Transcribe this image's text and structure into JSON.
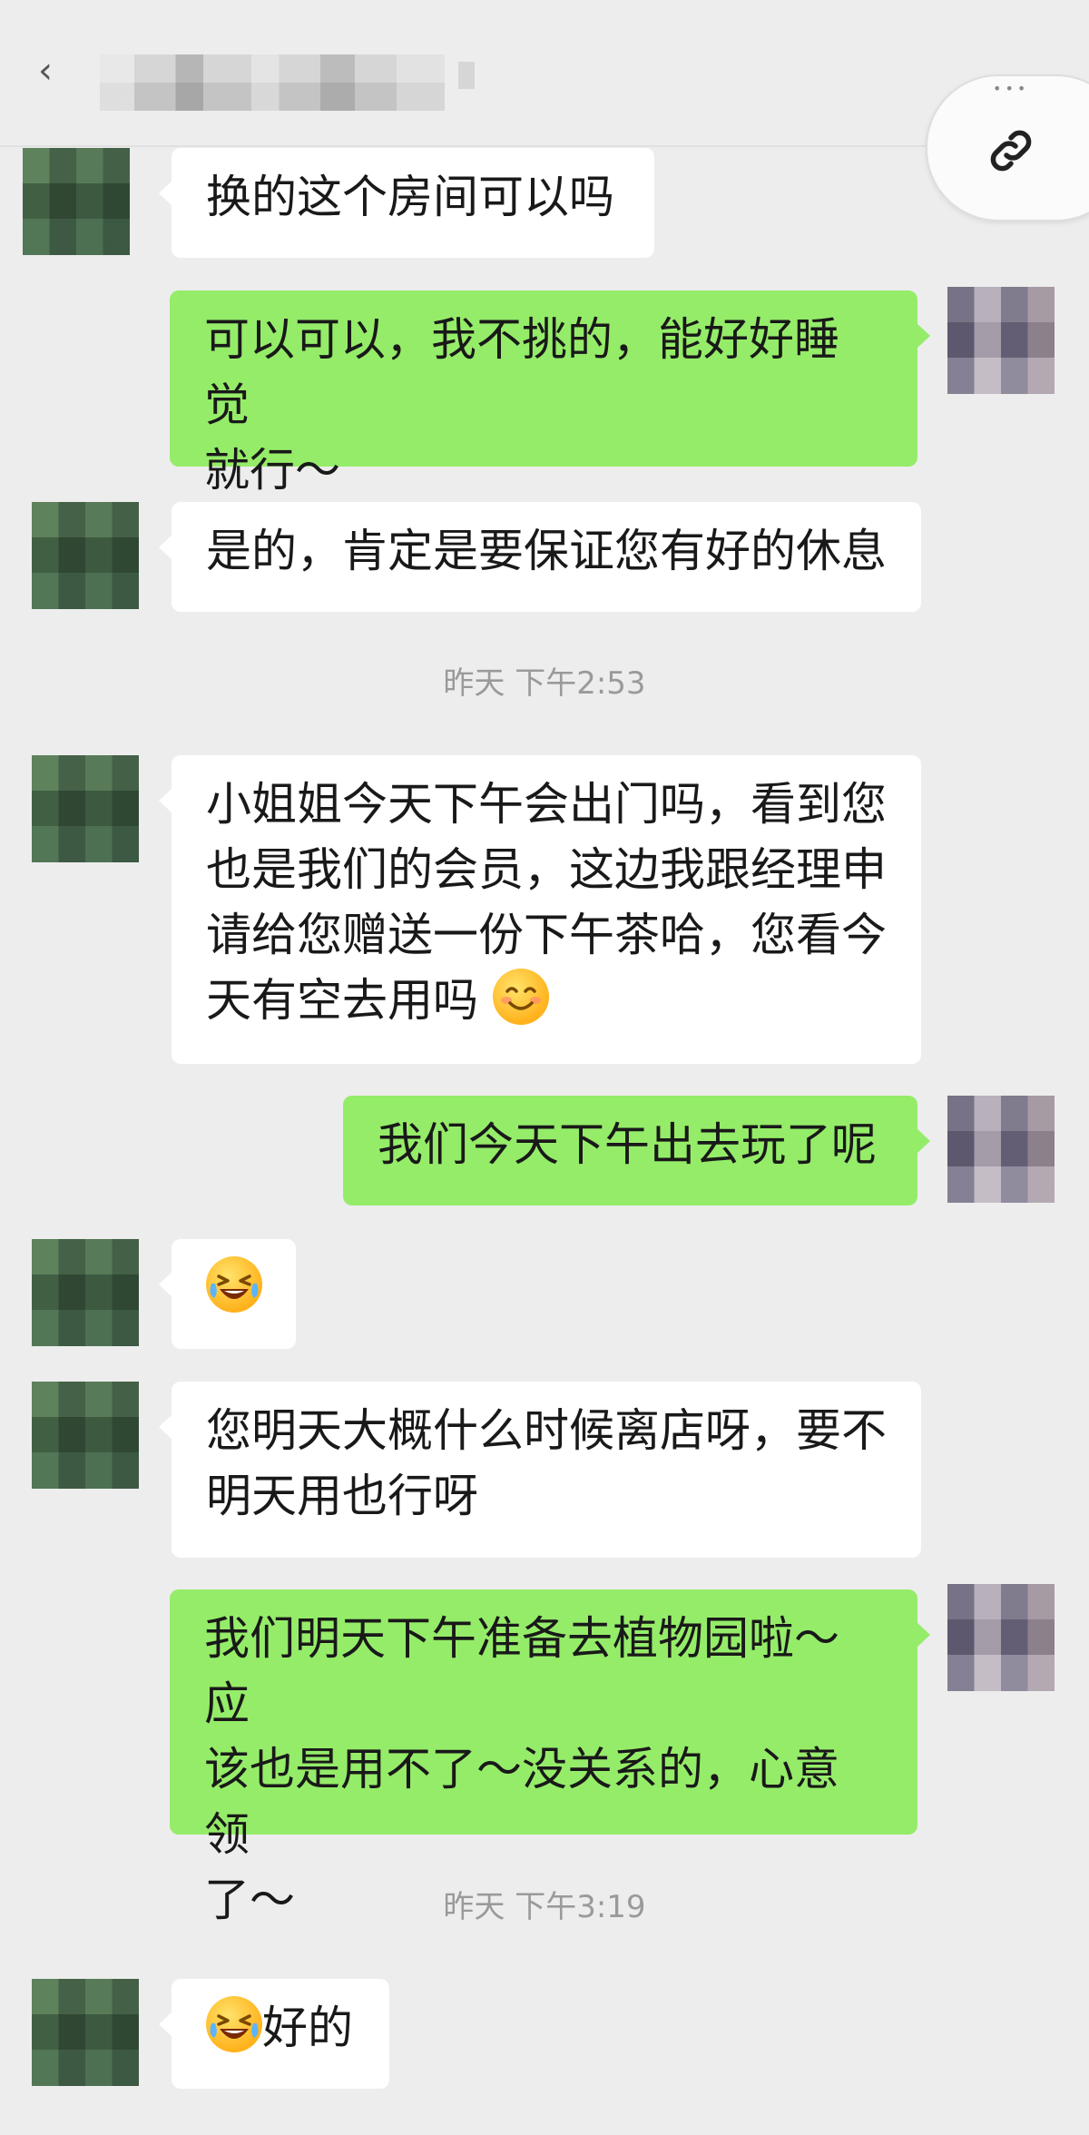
{
  "header": {
    "back_icon": "back-icon",
    "title_blurred": true,
    "link_button_icon": "link-icon",
    "more_indicator": "•••"
  },
  "colors": {
    "background": "#ededed",
    "incoming_bubble": "#ffffff",
    "outgoing_bubble": "#95ec69",
    "timestamp_text": "#9a9a9a"
  },
  "messages": [
    {
      "side": "in",
      "text": "换的这个房间可以吗"
    },
    {
      "side": "out",
      "line1": "可以可以，我不挑的，能好好睡觉",
      "line2": "就行～"
    },
    {
      "side": "in",
      "text": "是的，肯定是要保证您有好的休息"
    },
    {
      "side": "time",
      "text": "昨天 下午2:53"
    },
    {
      "side": "in",
      "line1": "小姐姐今天下午会出门吗，看到您",
      "line2": "也是我们的会员，这边我跟经理申",
      "line3": "请给您赠送一份下午茶哈，您看今",
      "line4": "天有空去用吗",
      "emoji": "smile-emoji"
    },
    {
      "side": "out",
      "text": "我们今天下午出去玩了呢"
    },
    {
      "side": "in",
      "emoji": "tears-of-joy-emoji"
    },
    {
      "side": "in",
      "line1": "您明天大概什么时候离店呀，要不",
      "line2": "明天用也行呀"
    },
    {
      "side": "out",
      "line1": "我们明天下午准备去植物园啦～应",
      "line2": "该也是用不了～没关系的，心意领",
      "line3": "了～"
    },
    {
      "side": "time",
      "text": "昨天 下午3:19"
    },
    {
      "side": "in",
      "text": "好的",
      "emoji": "tears-of-joy-emoji"
    }
  ]
}
